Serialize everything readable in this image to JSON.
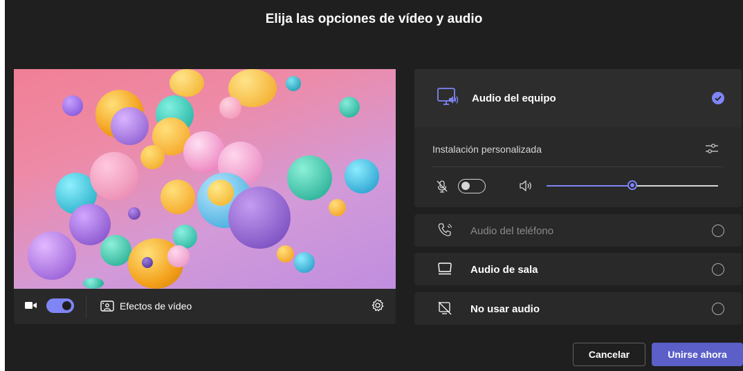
{
  "dialog": {
    "title": "Elija las opciones de vídeo y audio"
  },
  "video": {
    "camera_enabled": true,
    "effects_label": "Efectos de vídeo",
    "icons": [
      "video-camera-icon",
      "video-effects-icon",
      "gear-icon"
    ]
  },
  "audio": {
    "computer": {
      "label": "Audio del equipo",
      "selected": true,
      "icon": "computer-audio-icon"
    },
    "custom_setup_label": "Instalación personalizada",
    "mic_enabled": false,
    "speaker_volume_percent": 50,
    "phone": {
      "label": "Audio del teléfono",
      "selected": false,
      "disabled": true,
      "icon": "phone-audio-icon"
    },
    "room": {
      "label": "Audio de sala",
      "selected": false,
      "icon": "room-audio-icon"
    },
    "none": {
      "label": "No usar audio",
      "selected": false,
      "icon": "no-audio-icon"
    }
  },
  "actions": {
    "cancel_label": "Cancelar",
    "join_label": "Unirse ahora"
  },
  "colors": {
    "accent": "#7f85f5",
    "primary_button": "#5b5fc7",
    "background": "#1f1f1f",
    "panel": "#292929"
  }
}
